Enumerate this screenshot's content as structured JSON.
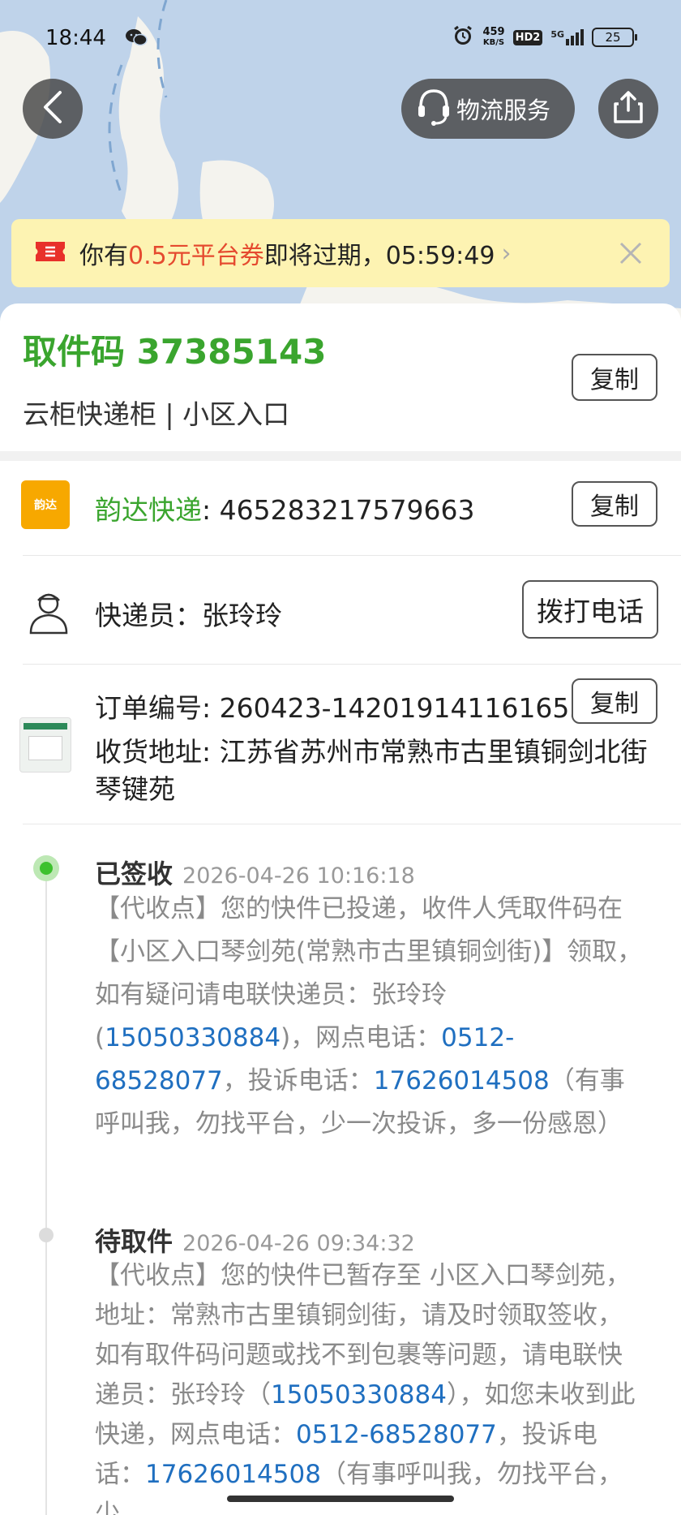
{
  "status_bar": {
    "time": "18:44",
    "net_speed_value": "459",
    "net_speed_unit": "KB/S",
    "hd": "HD2",
    "network": "5G",
    "battery": "25"
  },
  "header": {
    "service_label": "物流服务"
  },
  "coupon": {
    "prefix": "你有",
    "highlight": "0.5元平台券",
    "suffix": "即将过期，05:59:49"
  },
  "pickup": {
    "code_line": "取件码 37385143",
    "locker": "云柜快递柜 | 小区入口",
    "copy_label": "复制"
  },
  "shipment": {
    "logo_text": "韵达",
    "company": "韵达快递",
    "tracking_number": ": 465283217579663",
    "copy_label": "复制"
  },
  "courier": {
    "name_line": "快递员：张玲玲",
    "call_label": "拨打电话"
  },
  "order": {
    "order_line": "订单编号: 260423-142019141161655",
    "copy_label": "复制",
    "address": "收货地址: 江苏省苏州市常熟市古里镇铜剑北街琴键苑"
  },
  "timeline": [
    {
      "status": "已签收",
      "time": "2026-04-26 10:16:18",
      "text_a": "【代收点】您的快件已投递，收件人凭取件码在【小区入口琴剑苑(常熟市古里镇铜剑街)】领取，如有疑问请电联快递员：张玲玲(",
      "phone_a": "15050330884",
      "text_b": ")，网点电话：",
      "phone_b": "0512-68528077",
      "text_c": "，投诉电话：",
      "phone_c": "17626014508",
      "text_d": "（有事呼叫我，勿找平台，少一次投诉，多一份感恩）"
    },
    {
      "status": "待取件",
      "time": "2026-04-26 09:34:32",
      "text_a": "【代收点】您的快件已暂存至 小区入口琴剑苑，地址：常熟市古里镇铜剑街，请及时领取签收，如有取件码问题或找不到包裹等问题，请电联快递员：张玲玲（",
      "phone_a": "15050330884",
      "text_b": "），如您未收到此快递，网点电话：",
      "phone_b": "0512-68528077",
      "text_c": "，投诉电话：",
      "phone_c": "17626014508",
      "text_d": "（有事呼叫我，勿找平台，少"
    }
  ],
  "colors": {
    "accent_green": "#3aa52e",
    "link_blue": "#1f6fc0",
    "coupon_red": "#e54a2f",
    "coupon_bg": "#fdf3b2",
    "map_water": "#bfd3ea"
  },
  "icons": [
    "back-arrow-icon",
    "headset-icon",
    "share-icon",
    "coupon-ticket-icon",
    "close-icon",
    "courier-person-icon",
    "wechat-icon",
    "alarm-icon"
  ]
}
